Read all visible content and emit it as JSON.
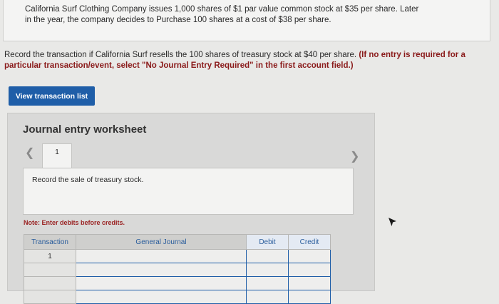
{
  "problem": {
    "line1": "California Surf Clothing Company issues 1,000 shares of $1 par value common stock at $35 per share. Later",
    "line2": "in the year, the company decides to Purchase 100 shares at a cost of $38 per share."
  },
  "instructions": {
    "text": "Record the transaction if California Surf resells the 100 shares of treasury stock at $40 per share.",
    "note1": "(If no entry is required for a",
    "note2": "particular transaction/event, select \"No Journal Entry Required\" in the first account field.)"
  },
  "buttons": {
    "view_transaction_list": "View transaction list"
  },
  "worksheet": {
    "title": "Journal entry worksheet",
    "tab_label": "1",
    "description": "Record the sale of treasury stock.",
    "note": "Note: Enter debits before credits.",
    "columns": [
      "Transaction",
      "General Journal",
      "Debit",
      "Credit"
    ],
    "rows": [
      [
        "1",
        "",
        "",
        ""
      ],
      [
        "",
        "",
        "",
        ""
      ],
      [
        "",
        "",
        "",
        ""
      ],
      [
        "",
        "",
        "",
        ""
      ]
    ]
  },
  "icons": {
    "prev": "chevron-left-icon",
    "next": "chevron-right-icon",
    "cursor": "mouse-pointer-icon"
  }
}
